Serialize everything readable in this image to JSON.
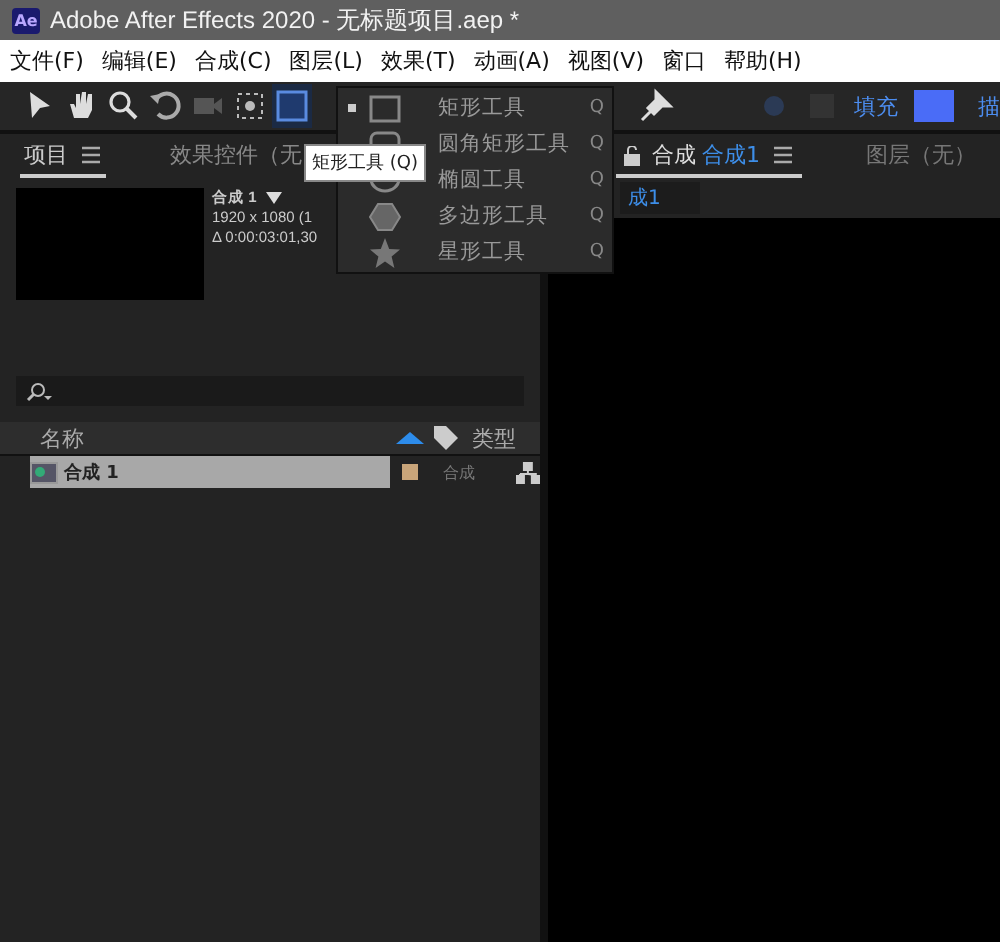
{
  "window": {
    "logo": "Ae",
    "title": "Adobe After Effects 2020 - 无标题项目.aep *"
  },
  "menu": [
    "文件(F)",
    "编辑(E)",
    "合成(C)",
    "图层(L)",
    "效果(T)",
    "动画(A)",
    "视图(V)",
    "窗口",
    "帮助(H)"
  ],
  "toolbar": {
    "tools": [
      {
        "kind": "arrow",
        "selected": false
      },
      {
        "kind": "hand",
        "selected": false
      },
      {
        "kind": "zoom",
        "selected": false
      },
      {
        "kind": "rotate",
        "selected": false
      },
      {
        "kind": "camera",
        "selected": false
      },
      {
        "kind": "anchor",
        "selected": false
      },
      {
        "kind": "rect",
        "selected": true
      }
    ],
    "fill": {
      "label": "填充",
      "color": "#4a6cf7"
    },
    "stroke": {
      "label": "描"
    }
  },
  "shape_menu": {
    "items": [
      {
        "kind": "rect",
        "label": "矩形工具",
        "shortcut": "Q",
        "selected": true
      },
      {
        "kind": "rounded",
        "label": "圆角矩形工具",
        "shortcut": "Q",
        "selected": false
      },
      {
        "kind": "ellipse",
        "label": "椭圆工具",
        "shortcut": "Q",
        "selected": false
      },
      {
        "kind": "polygon",
        "label": "多边形工具",
        "shortcut": "Q",
        "selected": false
      },
      {
        "kind": "star",
        "label": "星形工具",
        "shortcut": "Q",
        "selected": false
      }
    ]
  },
  "tooltip": "矩形工具 (Q)",
  "project_panel": {
    "tabs": [
      {
        "label": "项目",
        "selected": true
      },
      {
        "label": "效果控件（无",
        "selected": false
      }
    ],
    "comp_name": "合成 1",
    "resolution": "1920 x 1080 (1",
    "duration": "Δ 0:00:03:01,30",
    "columns": [
      "名称",
      "类型"
    ],
    "rows": [
      {
        "name": "合成 1",
        "type": "合成",
        "selected": true,
        "color": "#c9a57a"
      }
    ]
  },
  "comp_panel": {
    "tabs": [
      {
        "label": "合成",
        "name": "合成1",
        "selected": true
      },
      {
        "label": "图层（无）",
        "selected": false
      }
    ],
    "breadcrumb": "成1"
  }
}
